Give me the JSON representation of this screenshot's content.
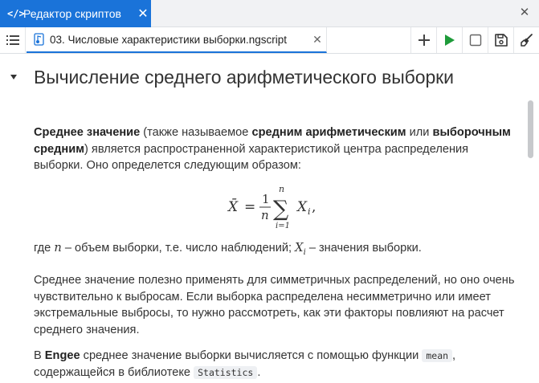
{
  "panel": {
    "tab_icon": "</>",
    "tab_label": "Редактор скриптов",
    "tab_close": "✕",
    "close": "✕"
  },
  "toolbar": {
    "file_tab_label": "03. Числовые характеристики выборки.ngscript",
    "file_tab_close": "✕"
  },
  "content": {
    "heading": "Вычисление среднего арифметического выборки",
    "para1": {
      "b1": "Среднее значение",
      "t1": " (также называемое ",
      "b2": "средним арифметическим",
      "t2": " или ",
      "b3": "выборочным средним",
      "t3": ") является распространенной характеристикой центра распределения выборки. Оно определется следующим образом:"
    },
    "formula": {
      "lhs": "X̄",
      "eq": "=",
      "num": "1",
      "den": "n",
      "sum_top": "n",
      "sum_sym": "∑",
      "sum_bottom": "i=1",
      "term": "X",
      "term_sub": "i",
      "tail": ","
    },
    "para2": {
      "t1": "где ",
      "n": "n",
      "t2": " – объем выборки, т.е. число наблюдений; ",
      "x": "X",
      "xi": "i",
      "t3": " – значения выборки."
    },
    "para3": "Среднее значение полезно применять для симметричных распределений, но оно очень чувствительно к выбросам. Если выборка распределена несимметрично или имеет экстремальные выбросы, то нужно рассмотреть, как эти факторы повлияют на расчет среднего значения.",
    "para4": {
      "t1": "В ",
      "b1": "Engee",
      "t2": " среднее значение выборки вычисляется с помощью функции ",
      "code1": "mean",
      "t3": ", содержащейся в библиотеке ",
      "code2": "Statistics",
      "t4": "."
    }
  },
  "colors": {
    "accent": "#1a73d9",
    "run": "#1e9b3a",
    "panel_bg": "#f1f2f4"
  }
}
